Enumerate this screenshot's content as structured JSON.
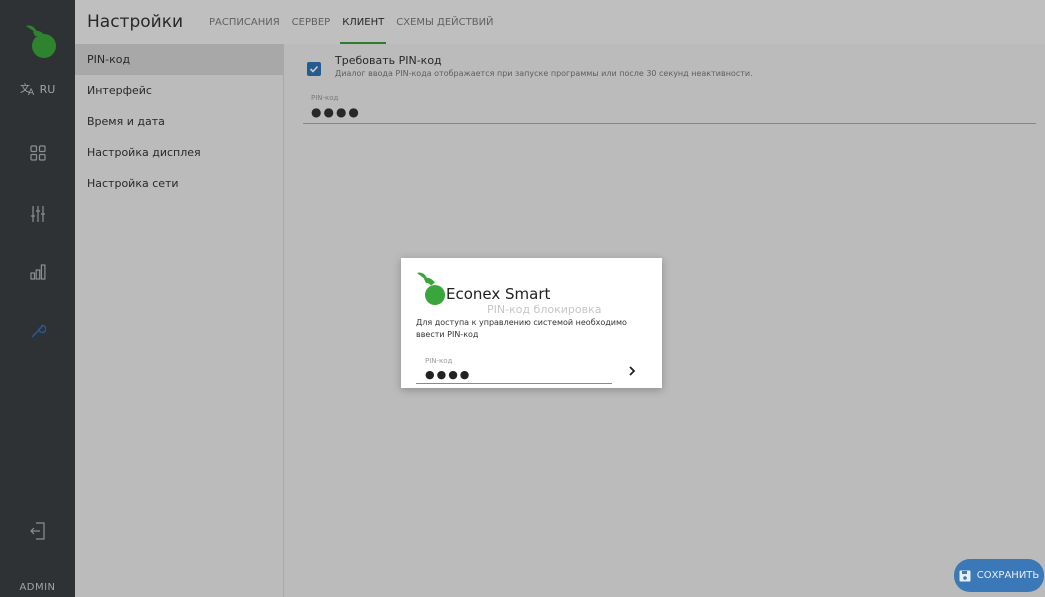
{
  "rail": {
    "language": "RU",
    "user": "ADMIN",
    "icons": [
      "translate-icon",
      "dashboard-grid-icon",
      "sliders-icon",
      "bar-chart-icon",
      "wrench-icon",
      "logout-icon"
    ]
  },
  "header": {
    "title": "Настройки",
    "tabs": [
      {
        "label": "РАСПИСАНИЯ",
        "active": false
      },
      {
        "label": "СЕРВЕР",
        "active": false
      },
      {
        "label": "КЛИЕНТ",
        "active": true
      },
      {
        "label": "СХЕМЫ ДЕЙСТВИЙ",
        "active": false
      }
    ]
  },
  "submenu": {
    "items": [
      {
        "label": "PIN-код",
        "active": true
      },
      {
        "label": "Интерфейс",
        "active": false
      },
      {
        "label": "Время и дата",
        "active": false
      },
      {
        "label": "Настройка дисплея",
        "active": false
      },
      {
        "label": "Настройка сети",
        "active": false
      }
    ]
  },
  "content": {
    "require_pin": {
      "checked": true,
      "title": "Требовать PIN-код",
      "description": "Диалог ввода PIN-кода отображается при запуске программы или после 30 секунд неактивности."
    },
    "pin_field": {
      "label": "PIN-код",
      "value": "●●●●"
    }
  },
  "dialog": {
    "brand": "Econex Smart",
    "subtitle": "PIN-код блокировка",
    "message": "Для доступа к управлению системой необходимо ввести PIN-код",
    "field": {
      "label": "PIN-код",
      "value": "●●●●"
    }
  },
  "save_button": {
    "label": "СОХРАНИТЬ"
  },
  "colors": {
    "accent": "#3a9a3a",
    "primary": "#3b78b8",
    "rail": "#3a3f43"
  }
}
